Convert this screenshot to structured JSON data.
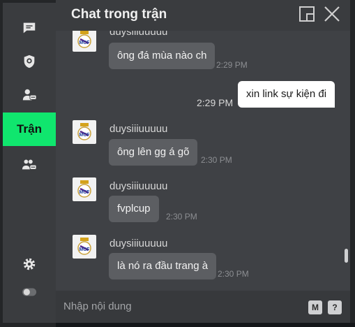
{
  "header": {
    "title": "Chat trong trận",
    "popout_icon": "popout-icon",
    "close_icon": "close-icon"
  },
  "sidebar": {
    "items": [
      {
        "name": "chat-bubble-icon"
      },
      {
        "name": "club-shield-icon"
      },
      {
        "name": "user-chat-icon"
      },
      {
        "label": "Trận"
      },
      {
        "name": "group-chat-icon"
      }
    ],
    "settings_icon": "gear-icon",
    "toggle_icon": "toggle-icon"
  },
  "messages": [
    {
      "user": "duysiiiuuuuu",
      "text": "ông đá mùa nào ch",
      "time": "2:29 PM"
    },
    {
      "mine": true,
      "text": "xin link sự kiện đi",
      "time": "2:29 PM"
    },
    {
      "user": "duysiiiuuuuu",
      "text": "ông lên gg á gõ",
      "time": "2:30 PM"
    },
    {
      "user": "duysiiiuuuuu",
      "text": "fvplcup",
      "time": "2:30 PM"
    },
    {
      "user": "duysiiiuuuuu",
      "text": "là nó ra đầu trang à",
      "time": "2:30 PM"
    }
  ],
  "composer": {
    "placeholder": "Nhập nội dung",
    "m_label": "M",
    "help_label": "?"
  },
  "colors": {
    "accent": "#10e66e",
    "panel": "#3f4145",
    "bubble": "#5c5e62"
  }
}
